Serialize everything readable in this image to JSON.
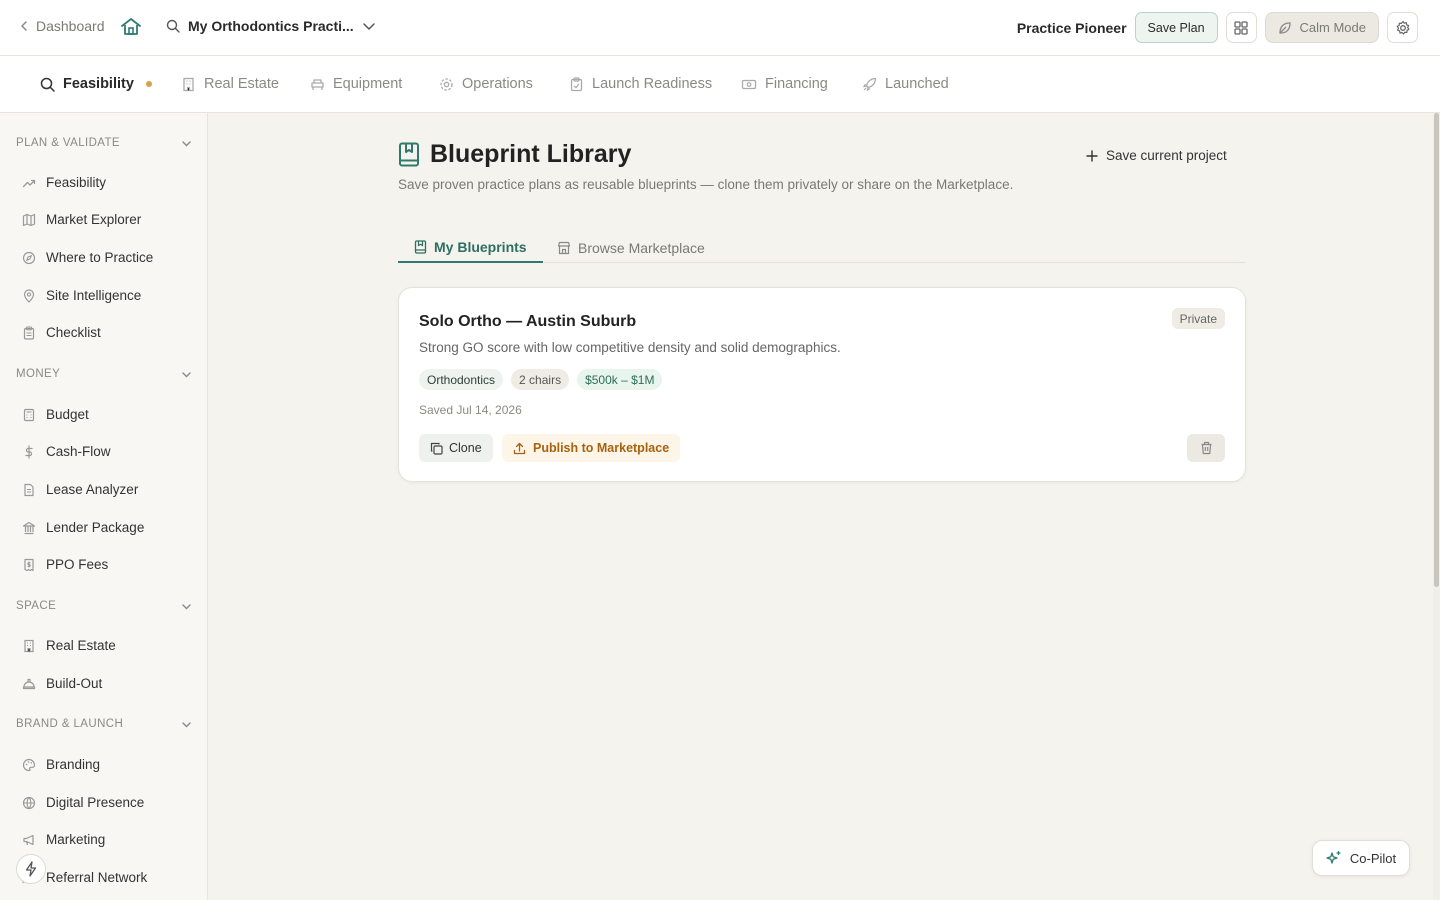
{
  "topbar": {
    "back_label": "Dashboard",
    "project_name": "My Orthodontics Practi...",
    "user_badge": "Practice Pioneer",
    "save_label": "Save Plan",
    "calm_label": "Calm Mode"
  },
  "stages": [
    {
      "label": "Feasibility",
      "icon": "search-icon",
      "active": true
    },
    {
      "label": "Real Estate",
      "icon": "building-icon"
    },
    {
      "label": "Equipment",
      "icon": "chair-icon"
    },
    {
      "label": "Operations",
      "icon": "gear-icon"
    },
    {
      "label": "Launch Readiness",
      "icon": "clipboard-icon"
    },
    {
      "label": "Financing",
      "icon": "banknote-icon"
    },
    {
      "label": "Launched",
      "icon": "rocket-icon"
    }
  ],
  "sidebar": {
    "sections": [
      {
        "title": "PLAN & VALIDATE",
        "items": [
          "Feasibility",
          "Market Explorer",
          "Where to Practice",
          "Site Intelligence",
          "Checklist"
        ]
      },
      {
        "title": "MONEY",
        "items": [
          "Budget",
          "Cash-Flow",
          "Lease Analyzer",
          "Lender Package",
          "PPO Fees"
        ]
      },
      {
        "title": "SPACE",
        "items": [
          "Real Estate",
          "Build-Out"
        ]
      },
      {
        "title": "BRAND & LAUNCH",
        "items": [
          "Branding",
          "Digital Presence",
          "Marketing",
          "Referral Network"
        ]
      }
    ]
  },
  "main": {
    "title": "Blueprint Library",
    "subtitle": "Save proven practice plans as reusable blueprints — clone them privately or share on the Marketplace.",
    "save_current": "Save current project",
    "tabs": [
      "My Blueprints",
      "Browse Marketplace"
    ],
    "card": {
      "title": "Solo Ortho — Austin Suburb",
      "description": "Strong GO score with low competitive density and solid demographics.",
      "visibility": "Private",
      "tags": [
        "Orthodontics",
        "2 chairs",
        "$500k – $1M"
      ],
      "saved": "Saved Jul 14, 2026",
      "clone_label": "Clone",
      "publish_label": "Publish to Marketplace"
    }
  },
  "copilot_label": "Co-Pilot",
  "colors": {
    "accent": "#2f7a6e",
    "warning": "#a8620f",
    "dot": "#d9a24a"
  }
}
